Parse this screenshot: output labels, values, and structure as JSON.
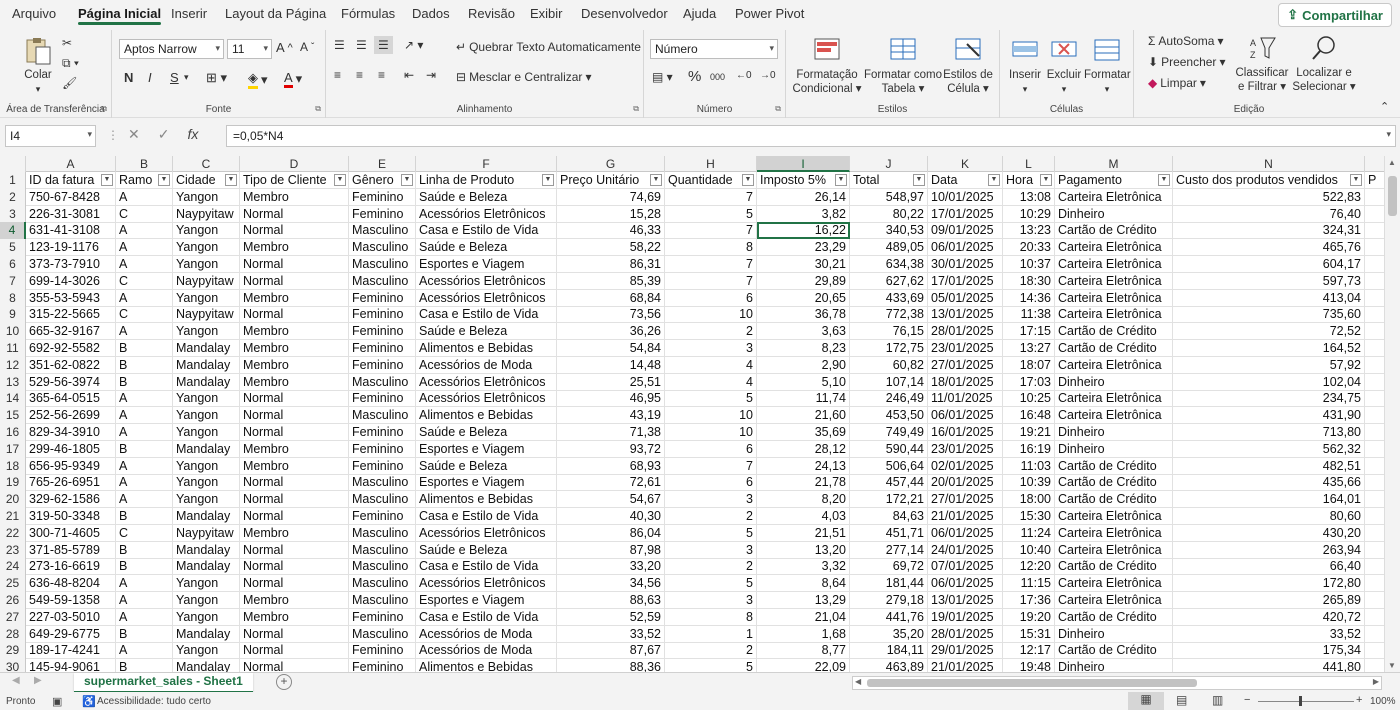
{
  "tabs": [
    "Arquivo",
    "Página Inicial",
    "Inserir",
    "Layout da Página",
    "Fórmulas",
    "Dados",
    "Revisão",
    "Exibir",
    "Desenvolvedor",
    "Ajuda",
    "Power Pivot"
  ],
  "share_label": "Compartilhar",
  "ribbon": {
    "clipboard": {
      "label": "Área de Transferência",
      "paste": "Colar"
    },
    "font": {
      "label": "Fonte",
      "name": "Aptos Narrow",
      "size": "11",
      "bold": "N",
      "italic": "I",
      "underline": "S"
    },
    "alignment": {
      "label": "Alinhamento",
      "wrap": "Quebrar Texto Automaticamente",
      "merge": "Mesclar e Centralizar"
    },
    "number": {
      "label": "Número",
      "format": "Número",
      "percent": "%",
      "thousands": "000"
    },
    "styles": {
      "label": "Estilos",
      "cond1": "Formatação",
      "cond2": "Condicional",
      "table1": "Formatar como",
      "table2": "Tabela",
      "cell1": "Estilos de",
      "cell2": "Célula"
    },
    "cells": {
      "label": "Células",
      "insert": "Inserir",
      "delete": "Excluir",
      "format": "Formatar"
    },
    "editing": {
      "label": "Edição",
      "autosum": "AutoSoma",
      "fill": "Preencher",
      "clear": "Limpar",
      "sort1": "Classificar",
      "sort2": "e Filtrar",
      "find1": "Localizar e",
      "find2": "Selecionar"
    }
  },
  "formula_bar": {
    "name_box": "I4",
    "formula": "=0,05*N4"
  },
  "columns": [
    "A",
    "B",
    "C",
    "D",
    "E",
    "F",
    "G",
    "H",
    "I",
    "J",
    "K",
    "L",
    "M",
    "N"
  ],
  "headers": [
    "ID da fatura",
    "Ramo",
    "Cidade",
    "Tipo de Cliente",
    "Gênero",
    "Linha de Produto",
    "Preço Unitário",
    "Quantidade",
    "Imposto 5%",
    "Total",
    "Data",
    "Hora",
    "Pagamento",
    "Custo dos produtos vendidos"
  ],
  "partial_header": "P",
  "rows": [
    [
      "750-67-8428",
      "A",
      "Yangon",
      "Membro",
      "Feminino",
      "Saúde e Beleza",
      "74,69",
      "7",
      "26,14",
      "548,97",
      "10/01/2025",
      "13:08",
      "Carteira Eletrônica",
      "522,83"
    ],
    [
      "226-31-3081",
      "C",
      "Naypyitaw",
      "Normal",
      "Feminino",
      "Acessórios Eletrônicos",
      "15,28",
      "5",
      "3,82",
      "80,22",
      "17/01/2025",
      "10:29",
      "Dinheiro",
      "76,40"
    ],
    [
      "631-41-3108",
      "A",
      "Yangon",
      "Normal",
      "Masculino",
      "Casa e Estilo de Vida",
      "46,33",
      "7",
      "16,22",
      "340,53",
      "09/01/2025",
      "13:23",
      "Cartão de Crédito",
      "324,31"
    ],
    [
      "123-19-1176",
      "A",
      "Yangon",
      "Membro",
      "Masculino",
      "Saúde e Beleza",
      "58,22",
      "8",
      "23,29",
      "489,05",
      "06/01/2025",
      "20:33",
      "Carteira Eletrônica",
      "465,76"
    ],
    [
      "373-73-7910",
      "A",
      "Yangon",
      "Normal",
      "Masculino",
      "Esportes e Viagem",
      "86,31",
      "7",
      "30,21",
      "634,38",
      "30/01/2025",
      "10:37",
      "Carteira Eletrônica",
      "604,17"
    ],
    [
      "699-14-3026",
      "C",
      "Naypyitaw",
      "Normal",
      "Masculino",
      "Acessórios Eletrônicos",
      "85,39",
      "7",
      "29,89",
      "627,62",
      "17/01/2025",
      "18:30",
      "Carteira Eletrônica",
      "597,73"
    ],
    [
      "355-53-5943",
      "A",
      "Yangon",
      "Membro",
      "Feminino",
      "Acessórios Eletrônicos",
      "68,84",
      "6",
      "20,65",
      "433,69",
      "05/01/2025",
      "14:36",
      "Carteira Eletrônica",
      "413,04"
    ],
    [
      "315-22-5665",
      "C",
      "Naypyitaw",
      "Normal",
      "Feminino",
      "Casa e Estilo de Vida",
      "73,56",
      "10",
      "36,78",
      "772,38",
      "13/01/2025",
      "11:38",
      "Carteira Eletrônica",
      "735,60"
    ],
    [
      "665-32-9167",
      "A",
      "Yangon",
      "Membro",
      "Feminino",
      "Saúde e Beleza",
      "36,26",
      "2",
      "3,63",
      "76,15",
      "28/01/2025",
      "17:15",
      "Cartão de Crédito",
      "72,52"
    ],
    [
      "692-92-5582",
      "B",
      "Mandalay",
      "Membro",
      "Feminino",
      "Alimentos e Bebidas",
      "54,84",
      "3",
      "8,23",
      "172,75",
      "23/01/2025",
      "13:27",
      "Cartão de Crédito",
      "164,52"
    ],
    [
      "351-62-0822",
      "B",
      "Mandalay",
      "Membro",
      "Feminino",
      "Acessórios de Moda",
      "14,48",
      "4",
      "2,90",
      "60,82",
      "27/01/2025",
      "18:07",
      "Carteira Eletrônica",
      "57,92"
    ],
    [
      "529-56-3974",
      "B",
      "Mandalay",
      "Membro",
      "Masculino",
      "Acessórios Eletrônicos",
      "25,51",
      "4",
      "5,10",
      "107,14",
      "18/01/2025",
      "17:03",
      "Dinheiro",
      "102,04"
    ],
    [
      "365-64-0515",
      "A",
      "Yangon",
      "Normal",
      "Feminino",
      "Acessórios Eletrônicos",
      "46,95",
      "5",
      "11,74",
      "246,49",
      "11/01/2025",
      "10:25",
      "Carteira Eletrônica",
      "234,75"
    ],
    [
      "252-56-2699",
      "A",
      "Yangon",
      "Normal",
      "Masculino",
      "Alimentos e Bebidas",
      "43,19",
      "10",
      "21,60",
      "453,50",
      "06/01/2025",
      "16:48",
      "Carteira Eletrônica",
      "431,90"
    ],
    [
      "829-34-3910",
      "A",
      "Yangon",
      "Normal",
      "Feminino",
      "Saúde e Beleza",
      "71,38",
      "10",
      "35,69",
      "749,49",
      "16/01/2025",
      "19:21",
      "Dinheiro",
      "713,80"
    ],
    [
      "299-46-1805",
      "B",
      "Mandalay",
      "Membro",
      "Feminino",
      "Esportes e Viagem",
      "93,72",
      "6",
      "28,12",
      "590,44",
      "23/01/2025",
      "16:19",
      "Dinheiro",
      "562,32"
    ],
    [
      "656-95-9349",
      "A",
      "Yangon",
      "Membro",
      "Feminino",
      "Saúde e Beleza",
      "68,93",
      "7",
      "24,13",
      "506,64",
      "02/01/2025",
      "11:03",
      "Cartão de Crédito",
      "482,51"
    ],
    [
      "765-26-6951",
      "A",
      "Yangon",
      "Normal",
      "Masculino",
      "Esportes e Viagem",
      "72,61",
      "6",
      "21,78",
      "457,44",
      "20/01/2025",
      "10:39",
      "Cartão de Crédito",
      "435,66"
    ],
    [
      "329-62-1586",
      "A",
      "Yangon",
      "Normal",
      "Masculino",
      "Alimentos e Bebidas",
      "54,67",
      "3",
      "8,20",
      "172,21",
      "27/01/2025",
      "18:00",
      "Cartão de Crédito",
      "164,01"
    ],
    [
      "319-50-3348",
      "B",
      "Mandalay",
      "Normal",
      "Feminino",
      "Casa e Estilo de Vida",
      "40,30",
      "2",
      "4,03",
      "84,63",
      "21/01/2025",
      "15:30",
      "Carteira Eletrônica",
      "80,60"
    ],
    [
      "300-71-4605",
      "C",
      "Naypyitaw",
      "Membro",
      "Masculino",
      "Acessórios Eletrônicos",
      "86,04",
      "5",
      "21,51",
      "451,71",
      "06/01/2025",
      "11:24",
      "Carteira Eletrônica",
      "430,20"
    ],
    [
      "371-85-5789",
      "B",
      "Mandalay",
      "Normal",
      "Masculino",
      "Saúde e Beleza",
      "87,98",
      "3",
      "13,20",
      "277,14",
      "24/01/2025",
      "10:40",
      "Carteira Eletrônica",
      "263,94"
    ],
    [
      "273-16-6619",
      "B",
      "Mandalay",
      "Normal",
      "Masculino",
      "Casa e Estilo de Vida",
      "33,20",
      "2",
      "3,32",
      "69,72",
      "07/01/2025",
      "12:20",
      "Cartão de Crédito",
      "66,40"
    ],
    [
      "636-48-8204",
      "A",
      "Yangon",
      "Normal",
      "Masculino",
      "Acessórios Eletrônicos",
      "34,56",
      "5",
      "8,64",
      "181,44",
      "06/01/2025",
      "11:15",
      "Carteira Eletrônica",
      "172,80"
    ],
    [
      "549-59-1358",
      "A",
      "Yangon",
      "Membro",
      "Masculino",
      "Esportes e Viagem",
      "88,63",
      "3",
      "13,29",
      "279,18",
      "13/01/2025",
      "17:36",
      "Carteira Eletrônica",
      "265,89"
    ],
    [
      "227-03-5010",
      "A",
      "Yangon",
      "Membro",
      "Feminino",
      "Casa e Estilo de Vida",
      "52,59",
      "8",
      "21,04",
      "441,76",
      "19/01/2025",
      "19:20",
      "Cartão de Crédito",
      "420,72"
    ],
    [
      "649-29-6775",
      "B",
      "Mandalay",
      "Normal",
      "Masculino",
      "Acessórios de Moda",
      "33,52",
      "1",
      "1,68",
      "35,20",
      "28/01/2025",
      "15:31",
      "Dinheiro",
      "33,52"
    ],
    [
      "189-17-4241",
      "A",
      "Yangon",
      "Normal",
      "Feminino",
      "Acessórios de Moda",
      "87,67",
      "2",
      "8,77",
      "184,11",
      "29/01/2025",
      "12:17",
      "Cartão de Crédito",
      "175,34"
    ],
    [
      "145-94-9061",
      "B",
      "Mandalay",
      "Normal",
      "Feminino",
      "Alimentos e Bebidas",
      "88,36",
      "5",
      "22,09",
      "463,89",
      "21/01/2025",
      "19:48",
      "Dinheiro",
      "441,80"
    ]
  ],
  "sheet_tab": "supermarket_sales - Sheet1",
  "status": {
    "ready": "Pronto",
    "accessibility": "Acessibilidade: tudo certo",
    "zoom": "100%"
  },
  "colors": {
    "accent": "#217346",
    "ribbon_bg": "#f3f3f3"
  }
}
